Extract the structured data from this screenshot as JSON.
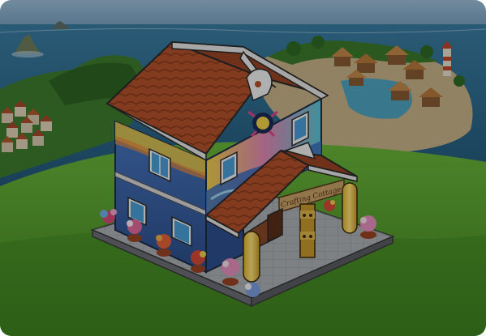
{
  "building": {
    "sign_text": "Crafting Cottage",
    "name": "crafting-cottage"
  },
  "colors": {
    "sky": "#7fa7c7",
    "sea": "#2c6f93",
    "sea_deep": "#1f4f6f",
    "grass": "#5aa02f",
    "grass_dark": "#3c7a1e",
    "roof": "#b5532c",
    "wall_blue": "#355fa6",
    "sand": "#c8b48c"
  },
  "scene": {
    "dimmed": true
  }
}
